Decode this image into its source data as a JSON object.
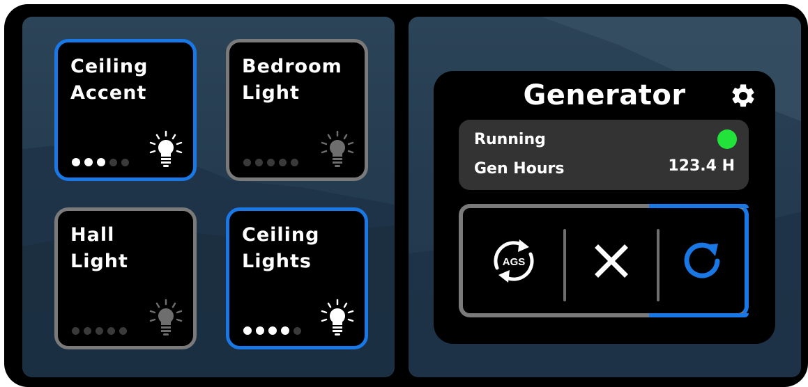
{
  "tiles": [
    {
      "label": "Ceiling\nAccent",
      "state": "on",
      "level": 3,
      "max_level": 5,
      "icon": "bulb-on-icon"
    },
    {
      "label": "Bedroom\nLight",
      "state": "off",
      "level": 0,
      "max_level": 5,
      "icon": "bulb-off-icon"
    },
    {
      "label": "Hall\nLight",
      "state": "off",
      "level": 0,
      "max_level": 5,
      "icon": "bulb-off-icon"
    },
    {
      "label": "Ceiling\nLights",
      "state": "on",
      "level": 4,
      "max_level": 5,
      "icon": "bulb-on-icon"
    }
  ],
  "generator": {
    "title": "Generator",
    "settings_icon": "gear-icon",
    "status_label": "Running",
    "status_color": "#22e33a",
    "hours_label": "Gen Hours",
    "hours_value": "123.4 H",
    "controls": [
      {
        "name": "ags",
        "text": "AGS",
        "icon": "ags-cycle-icon",
        "active": false
      },
      {
        "name": "stop",
        "icon": "close-icon",
        "active": false
      },
      {
        "name": "restart",
        "icon": "refresh-icon",
        "active": true
      }
    ]
  },
  "colors": {
    "active": "#1a78e6",
    "inactive": "#7a7a7a",
    "running": "#22e33a"
  }
}
